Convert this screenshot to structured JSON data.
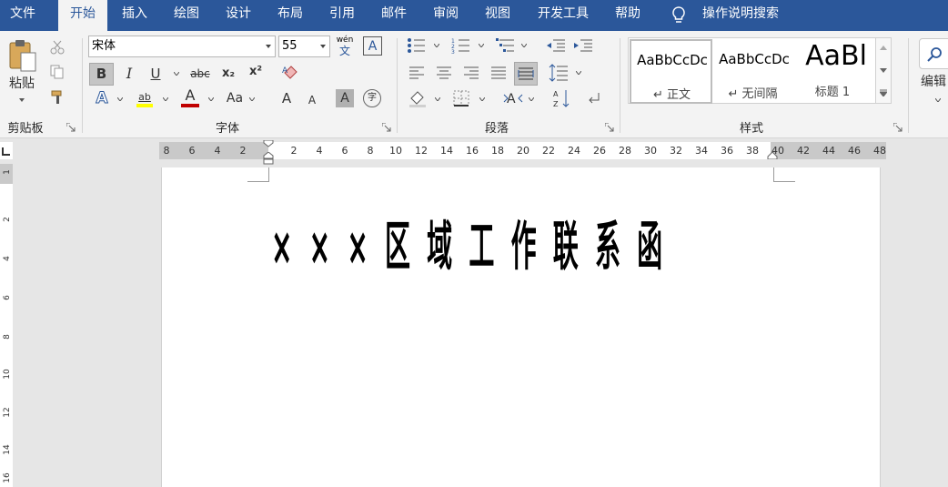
{
  "menubar": {
    "tabs": [
      "文件",
      "开始",
      "插入",
      "绘图",
      "设计",
      "布局",
      "引用",
      "邮件",
      "审阅",
      "视图",
      "开发工具",
      "帮助"
    ],
    "active_tab": "开始",
    "tell_me": "操作说明搜索"
  },
  "ribbon": {
    "clipboard": {
      "paste_label": "粘贴",
      "group_label": "剪贴板"
    },
    "font": {
      "font_name": "宋体",
      "font_size": "55",
      "phonetic_top": "wén",
      "phonetic_bottom": "文",
      "bold": "B",
      "italic": "I",
      "underline": "U",
      "strikethrough": "abc",
      "subscript": "x₂",
      "superscript": "x²",
      "text_effects": "A",
      "highlight": "ab",
      "font_color": "A",
      "change_case": "Aa",
      "grow_font": "A",
      "shrink_font": "A",
      "char_shading": "A",
      "enclose_char": "字",
      "char_border": "A",
      "group_label": "字体"
    },
    "paragraph": {
      "group_label": "段落"
    },
    "styles": {
      "items": [
        {
          "sample": "AaBbCcDc",
          "name": "↵ 正文"
        },
        {
          "sample": "AaBbCcDc",
          "name": "↵ 无间隔"
        },
        {
          "sample": "AaBl",
          "name": "标题 1"
        }
      ],
      "group_label": "样式"
    },
    "editing": {
      "label": "编辑"
    }
  },
  "ruler": {
    "left_labels": [
      "8",
      "6",
      "4",
      "2"
    ],
    "right_labels": [
      "2",
      "4",
      "6",
      "8",
      "10",
      "12",
      "14",
      "16",
      "18",
      "20",
      "22",
      "24",
      "26",
      "28",
      "30",
      "32",
      "34",
      "36",
      "38",
      "40",
      "42",
      "44",
      "46",
      "48"
    ]
  },
  "vertical_ruler": {
    "labels": [
      "1",
      "2",
      "4",
      "6",
      "8",
      "10",
      "12",
      "14",
      "16"
    ]
  },
  "document": {
    "title": "×××区域工作联系函"
  },
  "colors": {
    "accent": "#2b579a",
    "highlight": "#ffff00",
    "font_color": "#c00000",
    "bold_active": "#c5c5c5"
  }
}
